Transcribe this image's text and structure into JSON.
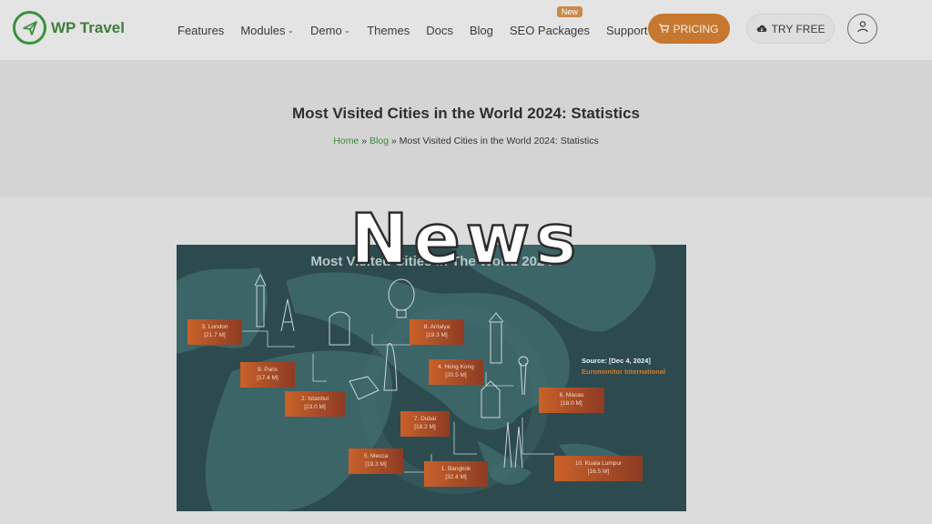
{
  "header": {
    "logo_text": "WP Travel",
    "nav": [
      {
        "label": "Features",
        "dropdown": false
      },
      {
        "label": "Modules",
        "dropdown": true
      },
      {
        "label": "Demo",
        "dropdown": true
      },
      {
        "label": "Themes",
        "dropdown": false
      },
      {
        "label": "Docs",
        "dropdown": false
      },
      {
        "label": "Blog",
        "dropdown": false
      },
      {
        "label": "SEO Packages",
        "dropdown": false,
        "badge": "New"
      },
      {
        "label": "Support",
        "dropdown": true
      }
    ],
    "pricing_label": "PRICING",
    "try_free_label": "TRY FREE"
  },
  "hero": {
    "title": "Most Visited Cities in the World 2024: Statistics",
    "breadcrumb": {
      "home": "Home",
      "sep1": " » ",
      "blog": "Blog",
      "sep2": " » ",
      "current": "Most Visited Cities in the World 2024: Statistics"
    }
  },
  "watermark": "News",
  "infographic": {
    "title": "Most Visited Cities in The World 2024",
    "source_label": "Source: [Dec 4, 2024]",
    "source_name": "Euromonitor International",
    "cities": [
      {
        "rank": "3. London",
        "value": "[21.7 M]"
      },
      {
        "rank": "9. Paris",
        "value": "[17.4 M]"
      },
      {
        "rank": "2. Istanbul",
        "value": "[23.0 M]"
      },
      {
        "rank": "8. Antalya",
        "value": "[19.3 M]"
      },
      {
        "rank": "4. Hong Kong",
        "value": "[20.5 M]"
      },
      {
        "rank": "7. Dubai",
        "value": "[18.2 M]"
      },
      {
        "rank": "6. Macau",
        "value": "[18.0 M]"
      },
      {
        "rank": "5. Mecca",
        "value": "[19.3 M]"
      },
      {
        "rank": "1. Bangkok",
        "value": "[32.4 M]"
      },
      {
        "rank": "10. Kuala Lumpur",
        "value": "[16.5 M]"
      }
    ]
  },
  "colors": {
    "brand_green": "#3f7d3a",
    "pricing_orange": "#c67730",
    "infographic_bg": "#2d4b4e",
    "label_orange": "#c9612a"
  }
}
